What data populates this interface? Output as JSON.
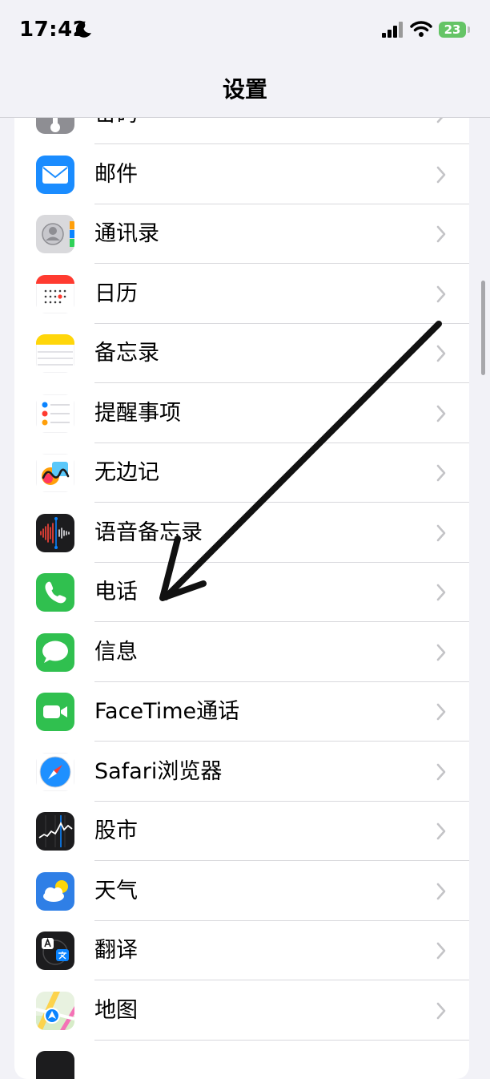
{
  "status_bar": {
    "time": "17:42",
    "battery": "23"
  },
  "nav": {
    "title": "设置"
  },
  "rows": [
    {
      "label": "密码",
      "icon": "key-icon"
    },
    {
      "label": "邮件",
      "icon": "mail-icon"
    },
    {
      "label": "通讯录",
      "icon": "contacts-icon"
    },
    {
      "label": "日历",
      "icon": "calendar-icon"
    },
    {
      "label": "备忘录",
      "icon": "notes-icon"
    },
    {
      "label": "提醒事项",
      "icon": "reminders-icon"
    },
    {
      "label": "无边记",
      "icon": "freeform-icon"
    },
    {
      "label": "语音备忘录",
      "icon": "voice-memos-icon"
    },
    {
      "label": "电话",
      "icon": "phone-icon"
    },
    {
      "label": "信息",
      "icon": "messages-icon"
    },
    {
      "label": "FaceTime通话",
      "icon": "facetime-icon"
    },
    {
      "label": "Safari浏览器",
      "icon": "safari-icon"
    },
    {
      "label": "股市",
      "icon": "stocks-icon"
    },
    {
      "label": "天气",
      "icon": "weather-icon"
    },
    {
      "label": "翻译",
      "icon": "translate-icon"
    },
    {
      "label": "地图",
      "icon": "maps-icon"
    }
  ],
  "colors": {
    "background": "#f2f2f7",
    "battery": "#65c466",
    "arrow": "#111111"
  }
}
